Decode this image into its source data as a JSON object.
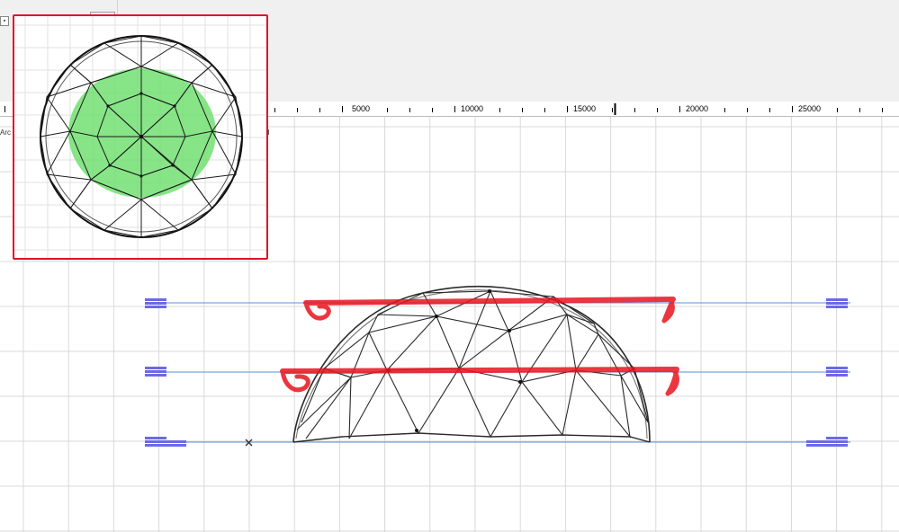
{
  "toolbar": {
    "small_button_glyph": "▪",
    "dropdown_arrow_glyph": "▸"
  },
  "ruler": {
    "labels": [
      "5000",
      "10000",
      "15000",
      "20000",
      "25000"
    ]
  },
  "canvas": {
    "side_label_left": "Arc",
    "side_label_right": "d",
    "level_colors": {
      "line": "#5a8fd6",
      "marker": "#6a6ae8"
    },
    "markup_color": "#e8141e",
    "highlight_color": "#5fdc5f"
  },
  "inset": {
    "border_color": "#e0102a"
  }
}
